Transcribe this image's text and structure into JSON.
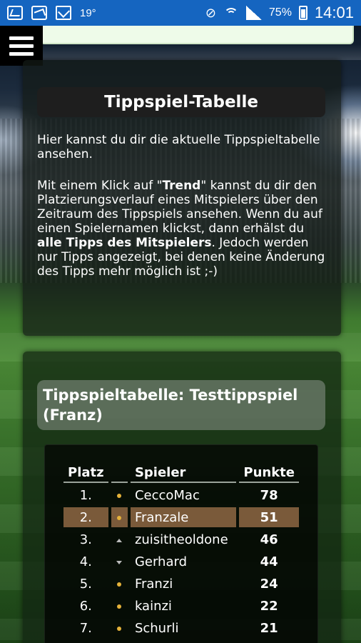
{
  "statusbar": {
    "temperature": "19°",
    "battery": "75%",
    "time": "14:01"
  },
  "info": {
    "title": "Tippspiel-Tabelle",
    "intro": "Hier kannst du dir die aktuelle Tippspieltabelle ansehen.",
    "p2_part1": "Mit einem Klick auf \"",
    "p2_trend": "Trend",
    "p2_part2": "\" kannst du dir den Platzierungsverlauf eines Mitspielers über den Zeitraum des Tippspiels ansehen. Wenn du auf einen Spielernamen klickst, dann erhälst du ",
    "p2_bold": "alle Tipps des Mitspielers",
    "p2_part3": ". Jedoch werden nur Tipps angezeigt, bei denen keine Änderung des Tipps mehr möglich ist ;-)"
  },
  "standings": {
    "title": "Tippspieltabelle: Testtippspiel (Franz)",
    "headers": {
      "platz": "Platz",
      "spieler": "Spieler",
      "punkte": "Punkte"
    },
    "rows": [
      {
        "platz": "1.",
        "trend": "same",
        "spieler": "CeccoMac",
        "punkte": "78"
      },
      {
        "platz": "2.",
        "trend": "same",
        "spieler": "Franzale",
        "punkte": "51",
        "highlight": true
      },
      {
        "platz": "3.",
        "trend": "up",
        "spieler": "zuisitheoldone",
        "punkte": "46"
      },
      {
        "platz": "4.",
        "trend": "down",
        "spieler": "Gerhard",
        "punkte": "44"
      },
      {
        "platz": "5.",
        "trend": "same",
        "spieler": "Franzi",
        "punkte": "24"
      },
      {
        "platz": "6.",
        "trend": "same",
        "spieler": "kainzi",
        "punkte": "22"
      },
      {
        "platz": "7.",
        "trend": "same",
        "spieler": "Schurli",
        "punkte": "21"
      }
    ]
  }
}
